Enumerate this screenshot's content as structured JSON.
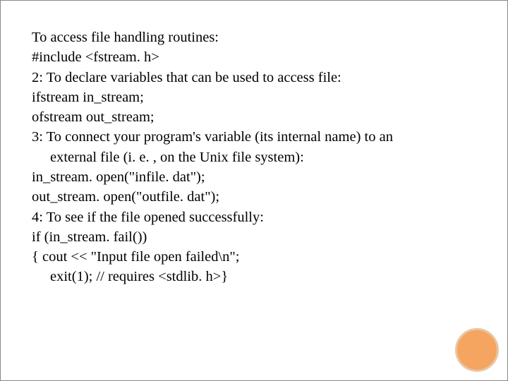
{
  "slide": {
    "lines": {
      "l1": "To access file handling routines:",
      "l2": "#include <fstream. h>",
      "l3": "2: To declare variables that can be used to access file:",
      "l4": "ifstream in_stream;",
      "l5": "ofstream out_stream;",
      "l6": "3: To connect your program's variable (its internal name) to an",
      "l7": "external file (i. e. , on the Unix file system):",
      "l8": "in_stream. open(\"infile. dat\");",
      "l9": "out_stream. open(\"outfile. dat\");",
      "l10": "4: To see if the file opened successfully:",
      "l11": "if (in_stream. fail())",
      "l12": "{    cout << \"Input file open failed\\n\";",
      "l13": "exit(1);        // requires <stdlib. h>}"
    }
  },
  "decor": {
    "accent_fill": "#f5a55f",
    "accent_ring": "#e7c7a4"
  }
}
